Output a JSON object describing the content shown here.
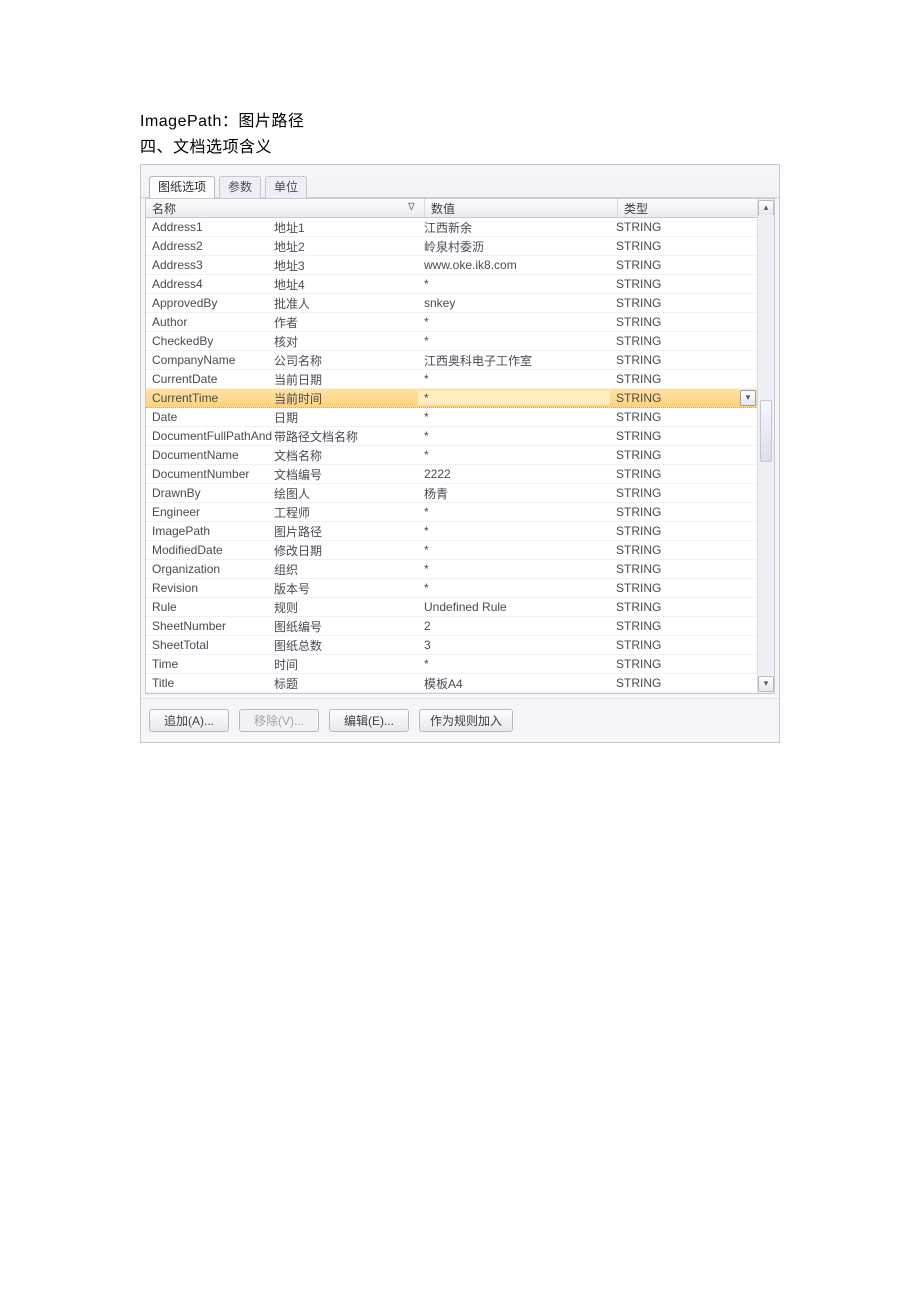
{
  "intro": {
    "line1": "ImagePath：图片路径",
    "line2": "四、文档选项含义"
  },
  "tabs": {
    "t0": "图纸选项",
    "t1": "参数",
    "t2": "单位"
  },
  "headers": {
    "name": "名称",
    "value": "数值",
    "type": "类型"
  },
  "rows": [
    {
      "key": "Address1",
      "zh": "地址1",
      "val": "江西新余",
      "type": "STRING"
    },
    {
      "key": "Address2",
      "zh": "地址2",
      "val": "岭泉村委沥",
      "type": "STRING"
    },
    {
      "key": "Address3",
      "zh": "地址3",
      "val": "www.oke.ik8.com",
      "type": "STRING"
    },
    {
      "key": "Address4",
      "zh": "地址4",
      "val": "*",
      "type": "STRING"
    },
    {
      "key": "ApprovedBy",
      "zh": "批准人",
      "val": "snkey",
      "type": "STRING"
    },
    {
      "key": "Author",
      "zh": "作者",
      "val": "*",
      "type": "STRING"
    },
    {
      "key": "CheckedBy",
      "zh": "核对",
      "val": "*",
      "type": "STRING"
    },
    {
      "key": "CompanyName",
      "zh": "公司名称",
      "val": "江西奥科电子工作室",
      "type": "STRING"
    },
    {
      "key": "CurrentDate",
      "zh": "当前日期",
      "val": "*",
      "type": "STRING"
    },
    {
      "key": "CurrentTime",
      "zh": "当前时间",
      "val": "*",
      "type": "STRING",
      "selected": true
    },
    {
      "key": "Date",
      "zh": "日期",
      "val": "*",
      "type": "STRING"
    },
    {
      "key": "DocumentFullPathAndName",
      "zh": "带路径文档名称",
      "val": "*",
      "type": "STRING"
    },
    {
      "key": "DocumentName",
      "zh": "文档名称",
      "val": "*",
      "type": "STRING"
    },
    {
      "key": "DocumentNumber",
      "zh": "文档编号",
      "val": "2222",
      "type": "STRING"
    },
    {
      "key": "DrawnBy",
      "zh": "绘图人",
      "val": "杨青",
      "type": "STRING"
    },
    {
      "key": "Engineer",
      "zh": "工程师",
      "val": "*",
      "type": "STRING"
    },
    {
      "key": "ImagePath",
      "zh": "图片路径",
      "val": "*",
      "type": "STRING"
    },
    {
      "key": "ModifiedDate",
      "zh": "修改日期",
      "val": "*",
      "type": "STRING"
    },
    {
      "key": "Organization",
      "zh": "组织",
      "val": "*",
      "type": "STRING"
    },
    {
      "key": "Revision",
      "zh": "版本号",
      "val": "*",
      "type": "STRING"
    },
    {
      "key": "Rule",
      "zh": "规则",
      "val": "Undefined Rule",
      "type": "STRING"
    },
    {
      "key": "SheetNumber",
      "zh": "图纸编号",
      "val": "2",
      "type": "STRING"
    },
    {
      "key": "SheetTotal",
      "zh": "图纸总数",
      "val": "3",
      "type": "STRING"
    },
    {
      "key": "Time",
      "zh": "时间",
      "val": "*",
      "type": "STRING"
    },
    {
      "key": "Title",
      "zh": "标题",
      "val": "模板A4",
      "type": "STRING"
    }
  ],
  "buttons": {
    "add": "追加(A)...",
    "remove": "移除(V)...",
    "edit": "编辑(E)...",
    "asrule": "作为规则加入"
  }
}
